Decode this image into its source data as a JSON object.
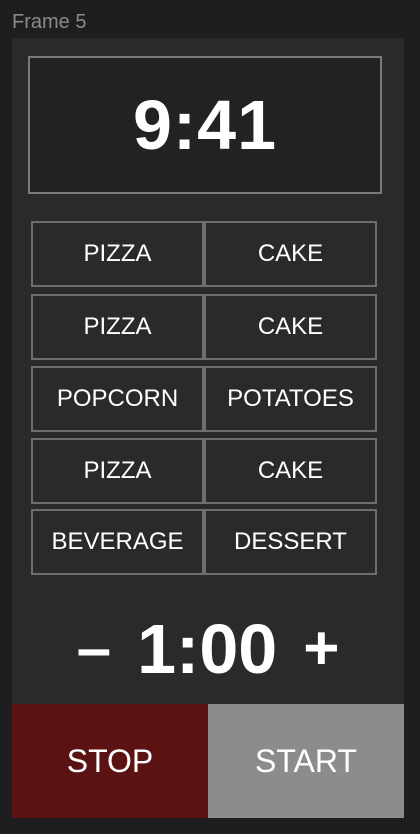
{
  "frame": {
    "label": "Frame 5"
  },
  "clock": {
    "time": "9:41"
  },
  "presets": [
    [
      "PIZZA",
      "CAKE"
    ],
    [
      "PIZZA",
      "CAKE"
    ],
    [
      "POPCORN",
      "POTATOES"
    ],
    [
      "PIZZA",
      "CAKE"
    ],
    [
      "BEVERAGE",
      "DESSERT"
    ]
  ],
  "timer": {
    "minus": "–",
    "value": "1:00",
    "plus": "+"
  },
  "actions": {
    "stop": "STOP",
    "start": "START"
  },
  "colors": {
    "stop_bg": "#5a1212",
    "start_bg": "#8c8c8c",
    "panel_bg": "#2a2a2a",
    "border": "#6e6e6e"
  }
}
